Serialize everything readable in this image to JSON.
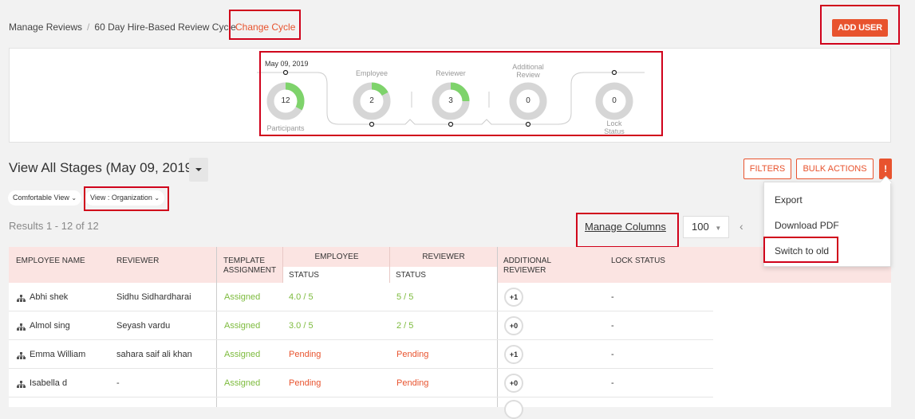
{
  "breadcrumb": {
    "root": "Manage Reviews",
    "separator": "/",
    "cycle": "60 Day Hire-Based Review Cycle",
    "change_link": "Change Cycle"
  },
  "header": {
    "add_user_label": "ADD USER"
  },
  "summary": {
    "date": "May 09, 2019",
    "stages": [
      {
        "label": "Participants",
        "value": "12",
        "fill": 0.33
      },
      {
        "label": "Employee",
        "value": "2",
        "fill": 0.17
      },
      {
        "label": "Reviewer",
        "value": "3",
        "fill": 0.25
      },
      {
        "label": "Additional\nReview",
        "value": "0",
        "fill": 0
      },
      {
        "label": "Lock\nStatus",
        "value": "0",
        "fill": 0
      }
    ]
  },
  "section": {
    "title": "View All Stages (May 09, 2019)",
    "filters_label": "FILTERS",
    "bulk_actions_label": "BULK ACTIONS",
    "more_label": "!",
    "view_mode": "Comfortable View",
    "view_org": "View : Organization",
    "results": "Results 1 - 12 of 12",
    "manage_columns": "Manage Columns",
    "page_size": "100"
  },
  "menu": {
    "items": [
      "Export",
      "Download PDF",
      "Switch to old"
    ]
  },
  "table": {
    "headers": {
      "employee_name": "EMPLOYEE NAME",
      "reviewer": "REVIEWER",
      "template_assignment": "TEMPLATE ASSIGNMENT",
      "employee": "EMPLOYEE",
      "employee_status": "STATUS",
      "reviewer_group": "REVIEWER",
      "reviewer_status": "STATUS",
      "additional_reviewer": "ADDITIONAL REVIEWER",
      "lock_status": "LOCK STATUS"
    },
    "rows": [
      {
        "name": "Abhi shek",
        "reviewer": "Sidhu Sidhardharai",
        "template": "Assigned",
        "emp_status": "4.0 / 5",
        "rev_status": "5 / 5",
        "additional": "+1",
        "lock": "-"
      },
      {
        "name": "Almol sing",
        "reviewer": "Seyash vardu",
        "template": "Assigned",
        "emp_status": "3.0 / 5",
        "rev_status": "2 / 5",
        "additional": "+0",
        "lock": "-"
      },
      {
        "name": "Emma William",
        "reviewer": "sahara saif ali khan",
        "template": "Assigned",
        "emp_status": "Pending",
        "rev_status": "Pending",
        "additional": "+1",
        "lock": "-"
      },
      {
        "name": "Isabella d",
        "reviewer": "-",
        "template": "Assigned",
        "emp_status": "Pending",
        "rev_status": "Pending",
        "additional": "+0",
        "lock": "-"
      }
    ]
  },
  "colors": {
    "accent": "#e8532e",
    "highlight_box": "#d0021b",
    "success": "#7dbb3d",
    "donut_track": "#d6d6d6",
    "donut_fill": "#7ed36b"
  }
}
